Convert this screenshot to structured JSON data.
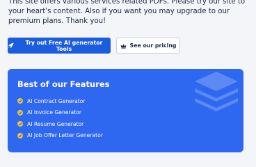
{
  "intro": {
    "text": "This site offers various services related PDFs. Please try our site to your heart's content. Also if you want you may upgrade to our premium plans. Thank you!"
  },
  "buttons": {
    "primary_label": "Try out Free AI generator Tools",
    "primary_icon": "rocket-icon",
    "secondary_label": "See our pricing",
    "secondary_icon": "crown-icon"
  },
  "features": {
    "title": "Best of our Features",
    "items": [
      {
        "label": "AI Contract Generator"
      },
      {
        "label": "AI Invoice Generator"
      },
      {
        "label": "AI Resume Generator"
      },
      {
        "label": "AI Job Offer Letter Generator"
      }
    ],
    "decor_icon": "layers-stack-icon"
  },
  "colors": {
    "primary": "#1c5de0",
    "panel": "#2f68f0",
    "check": "#f0c530",
    "background": "#f3f5f9"
  }
}
